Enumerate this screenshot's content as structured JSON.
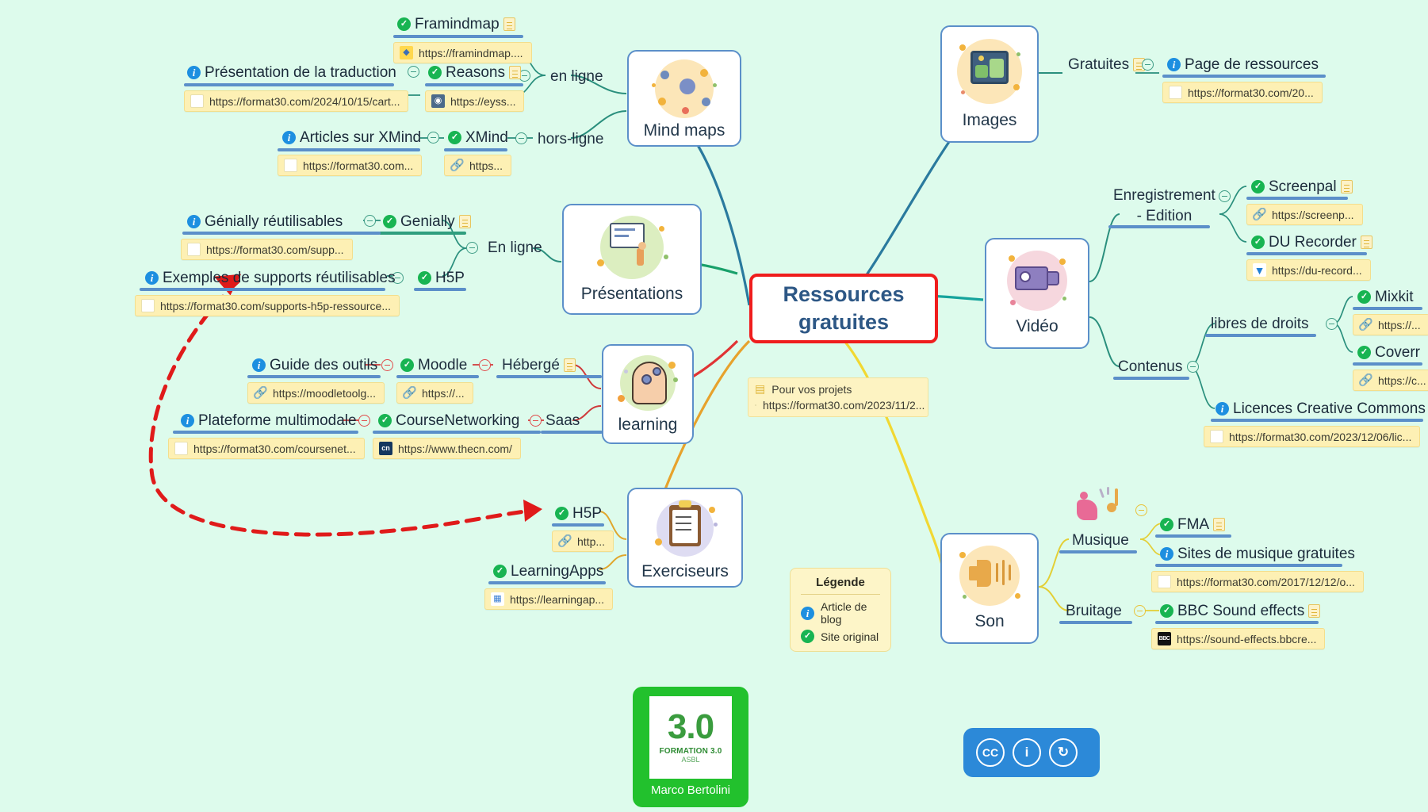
{
  "central": {
    "line1": "Ressources",
    "line2": "gratuites",
    "border_color": "#ef1d1d",
    "text_color": "#2d5785"
  },
  "canvas": {
    "background": "#ddfbec"
  },
  "branches": {
    "mindmaps": {
      "label": "Mind maps",
      "subtopics": [
        {
          "label": "en ligne"
        },
        {
          "label": "hors-ligne"
        }
      ],
      "items": [
        {
          "label": "Framindmap",
          "badge": "check",
          "doc": true,
          "url": "https://framindmap....",
          "favicon": "framindmap"
        },
        {
          "label": "Reasons",
          "badge": "check",
          "doc": true,
          "url": "https://eyss...",
          "favicon": "eyss"
        },
        {
          "label": "Présentation de la traduction",
          "badge": "info",
          "doc": false,
          "url": "https://format30.com/2024/10/15/cart...",
          "favicon": "blank"
        },
        {
          "label": "XMind",
          "badge": "check",
          "doc": false,
          "url": "https...",
          "favicon": "link"
        },
        {
          "label": "Articles sur XMind",
          "badge": "info",
          "doc": false,
          "url": "https://format30.com...",
          "favicon": "blank"
        }
      ]
    },
    "presentations": {
      "label": "Présentations",
      "subtopics": [
        {
          "label": "En ligne"
        }
      ],
      "items": [
        {
          "label": "Genially",
          "badge": "check",
          "doc": true
        },
        {
          "label": "Génially réutilisables",
          "badge": "info",
          "doc": false,
          "url": "https://format30.com/supp...",
          "favicon": "blank"
        },
        {
          "label": "H5P",
          "badge": "check",
          "doc": false
        },
        {
          "label": "Exemples de supports réutilisables",
          "badge": "info",
          "doc": false,
          "url": "https://format30.com/supports-h5p-ressource...",
          "favicon": "blank"
        }
      ]
    },
    "learning": {
      "label": "learning",
      "subtopics": [
        {
          "label": "Hébergé"
        },
        {
          "label": "Saas"
        }
      ],
      "items": [
        {
          "label": "Moodle",
          "badge": "check",
          "url": "https://...",
          "favicon": "link"
        },
        {
          "label": "Guide des outils",
          "badge": "info",
          "url": "https://moodletoolg...",
          "favicon": "link"
        },
        {
          "label": "CourseNetworking",
          "badge": "check",
          "url": "https://www.thecn.com/",
          "favicon": "cn"
        },
        {
          "label": "Plateforme multimodale",
          "badge": "info",
          "url": "https://format30.com/coursenet...",
          "favicon": "blank"
        }
      ]
    },
    "exerciseurs": {
      "label": "Exerciseurs",
      "items": [
        {
          "label": "H5P",
          "badge": "check",
          "url": "http...",
          "favicon": "link"
        },
        {
          "label": "LearningApps",
          "badge": "check",
          "url": "https://learningap...",
          "favicon": "la"
        }
      ]
    },
    "images": {
      "label": "Images",
      "subtopics": [
        {
          "label": "Gratuites",
          "doc": true
        }
      ],
      "items": [
        {
          "label": "Page de ressources",
          "badge": "info",
          "url": "https://format30.com/20...",
          "favicon": "blank"
        }
      ]
    },
    "video": {
      "label": "Vidéo",
      "subtopics": [
        {
          "label": "Enregistrement\n- Edition"
        },
        {
          "label": "Contenus"
        },
        {
          "label": "libres de droits"
        }
      ],
      "items": [
        {
          "label": "Screenpal",
          "badge": "check",
          "doc": true,
          "url": "https://screenp...",
          "favicon": "link"
        },
        {
          "label": "DU Recorder",
          "badge": "check",
          "doc": true,
          "url": "https://du-record...",
          "favicon": "du"
        },
        {
          "label": "Mixkit",
          "badge": "check",
          "url": "https://...",
          "favicon": "link"
        },
        {
          "label": "Coverr",
          "badge": "check",
          "url": "https://c...",
          "favicon": "link"
        },
        {
          "label": "Licences Creative Commons",
          "badge": "info",
          "url": "https://format30.com/2023/12/06/lic...",
          "favicon": "blank"
        }
      ]
    },
    "son": {
      "label": "Son",
      "subtopics": [
        {
          "label": "Musique"
        },
        {
          "label": "Bruitage"
        }
      ],
      "items": [
        {
          "label": "FMA",
          "badge": "check",
          "doc": true
        },
        {
          "label": "Sites de musique gratuites",
          "badge": "info",
          "url": "https://format30.com/2017/12/12/o...",
          "favicon": "blank"
        },
        {
          "label": "BBC Sound effects",
          "badge": "check",
          "doc": true,
          "url": "https://sound-effects.bbcre...",
          "favicon": "bbc"
        }
      ]
    }
  },
  "projects_note": {
    "title": "Pour vos projets",
    "url": "https://format30.com/2023/11/2..."
  },
  "legend": {
    "title": "Légende",
    "rows": [
      {
        "icon": "info",
        "label": "Article de blog"
      },
      {
        "icon": "check",
        "label": "Site original"
      }
    ]
  },
  "logo": {
    "number": "3.0",
    "line1": "FORMATION 3.0",
    "line2": "ASBL",
    "author": "Marco Bertolini"
  },
  "cc_badge": {
    "cc": "CC",
    "by": "i",
    "sa": "↻"
  }
}
